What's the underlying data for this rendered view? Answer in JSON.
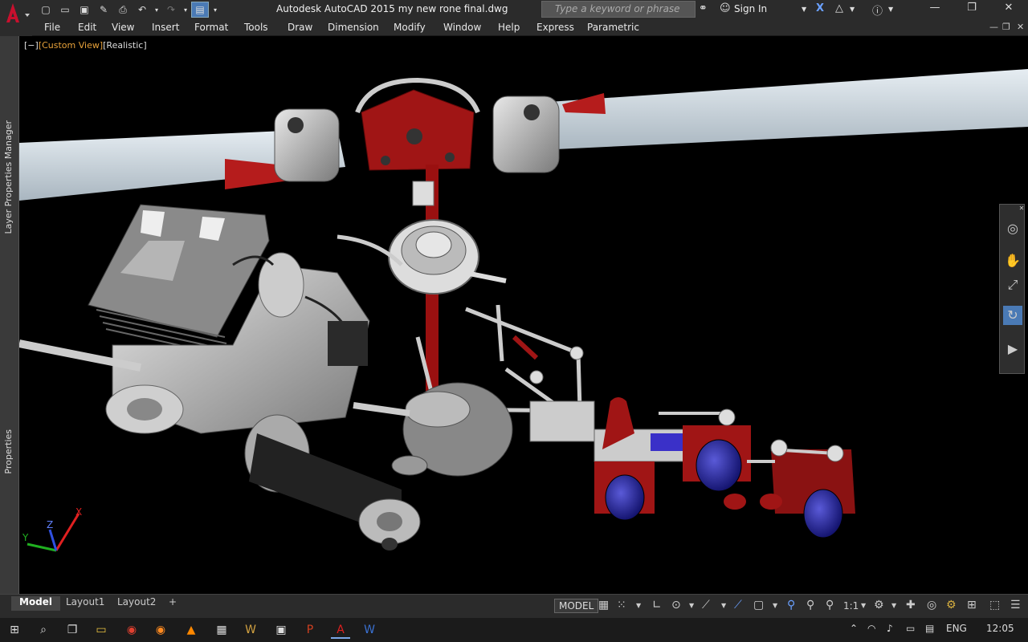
{
  "window": {
    "title": "Autodesk AutoCAD 2015    my new rone final.dwg",
    "search_placeholder": "Type a keyword or phrase",
    "sign_in": "Sign In"
  },
  "menu": [
    "File",
    "Edit",
    "View",
    "Insert",
    "Format",
    "Tools",
    "Draw",
    "Dimension",
    "Modify",
    "Window",
    "Help",
    "Express",
    "Parametric"
  ],
  "viewport": {
    "control": "[−]",
    "view": "[Custom View]",
    "style": "[Realistic]"
  },
  "palettes": [
    "Layer Properties Manager",
    "Properties"
  ],
  "layout_tabs": [
    "Model",
    "Layout1",
    "Layout2"
  ],
  "status": {
    "model": "MODEL",
    "scale": "1:1"
  },
  "taskbar": {
    "language": "ENG",
    "time": "12:05"
  },
  "colors": {
    "accent": "#4a7ab5",
    "title_bg": "#2b2b2b",
    "viewport_bg": "#000000",
    "custom_view_text": "#e8a23a",
    "blade": "#c9d3db",
    "red_part": "#a01515",
    "blue_motor": "#1a1a8c"
  },
  "ucs": {
    "x": "X",
    "y": "Y",
    "z": "Z"
  }
}
